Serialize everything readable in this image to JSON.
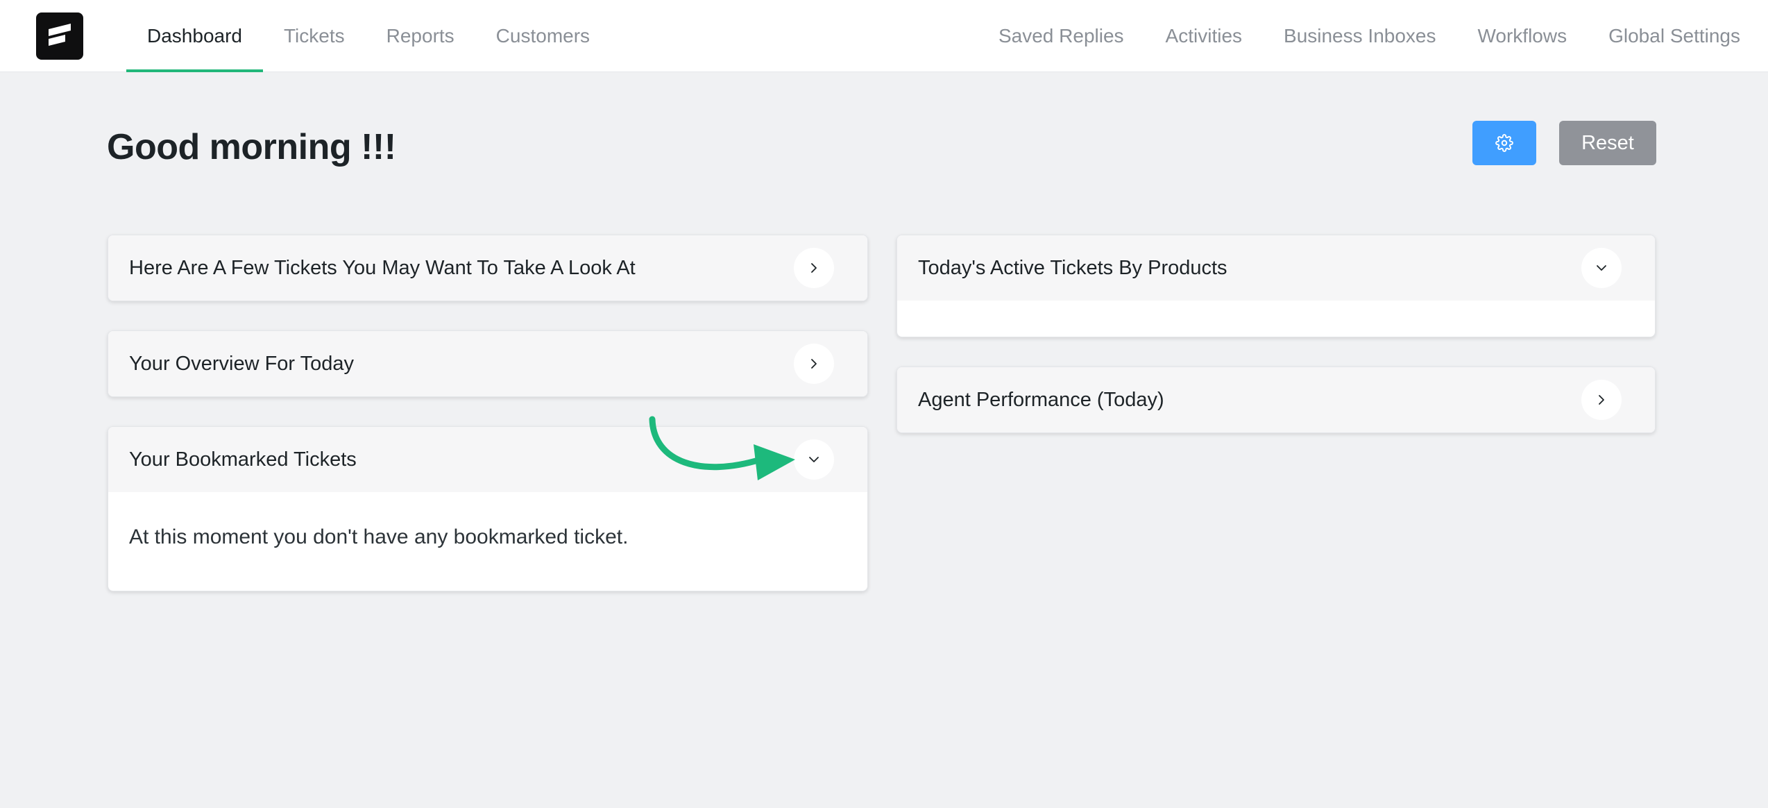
{
  "app": {
    "logo": "fluent-support-logo"
  },
  "nav": {
    "left": [
      {
        "label": "Dashboard",
        "active": true
      },
      {
        "label": "Tickets",
        "active": false
      },
      {
        "label": "Reports",
        "active": false
      },
      {
        "label": "Customers",
        "active": false
      }
    ],
    "right": [
      {
        "label": "Saved Replies"
      },
      {
        "label": "Activities"
      },
      {
        "label": "Business Inboxes"
      },
      {
        "label": "Workflows"
      },
      {
        "label": "Global Settings"
      }
    ]
  },
  "page": {
    "title": "Good morning !!!",
    "settings_icon": "gear-icon",
    "reset_label": "Reset"
  },
  "cards": {
    "look_at": {
      "title": "Here Are A Few Tickets You May Want To Take A Look At",
      "icon": "chevron-right-icon"
    },
    "overview": {
      "title": "Your Overview For Today",
      "icon": "chevron-right-icon"
    },
    "bookmarked": {
      "title": "Your Bookmarked Tickets",
      "icon": "chevron-down-icon",
      "empty_text": "At this moment you don't have any bookmarked ticket."
    },
    "active_products": {
      "title": "Today's Active Tickets By Products",
      "icon": "chevron-down-icon"
    },
    "agent_performance": {
      "title": "Agent Performance (Today)",
      "icon": "chevron-right-icon"
    }
  },
  "colors": {
    "accent": "#22b77a",
    "primary_button": "#409eff",
    "secondary_button": "#909399",
    "background": "#f0f1f3"
  }
}
